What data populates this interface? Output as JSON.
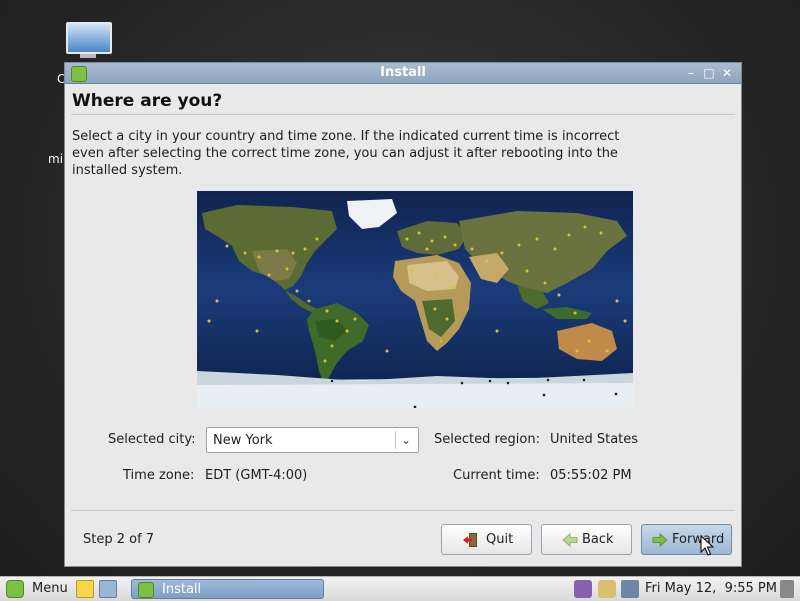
{
  "desktop": {
    "icon_label_fragments": [
      "C",
      "mi"
    ]
  },
  "window": {
    "title": "Install",
    "heading": "Where are you?",
    "description": "Select a city in your country and time zone. If the indicated current time is incorrect even after selecting the correct time zone, you can adjust it after rebooting into the installed system.",
    "selected_city_label": "Selected city:",
    "selected_city_value": "New York",
    "selected_region_label": "Selected region:",
    "selected_region_value": "United States",
    "time_zone_label": "Time zone:",
    "time_zone_value": "EDT (GMT-4:00)",
    "current_time_label": "Current time:",
    "current_time_value": "05:55:02 PM",
    "step": "Step 2 of 7",
    "buttons": {
      "quit": "Quit",
      "back": "Back",
      "forward": "Forward"
    }
  },
  "taskbar": {
    "menu_label": "Menu",
    "task_label": "Install",
    "clock": "Fri May 12,  9:55 PM"
  },
  "colors": {
    "accent_green": "#7ec045",
    "titlebar": "#8ea5bf",
    "ocean": "#1b3b7a"
  }
}
